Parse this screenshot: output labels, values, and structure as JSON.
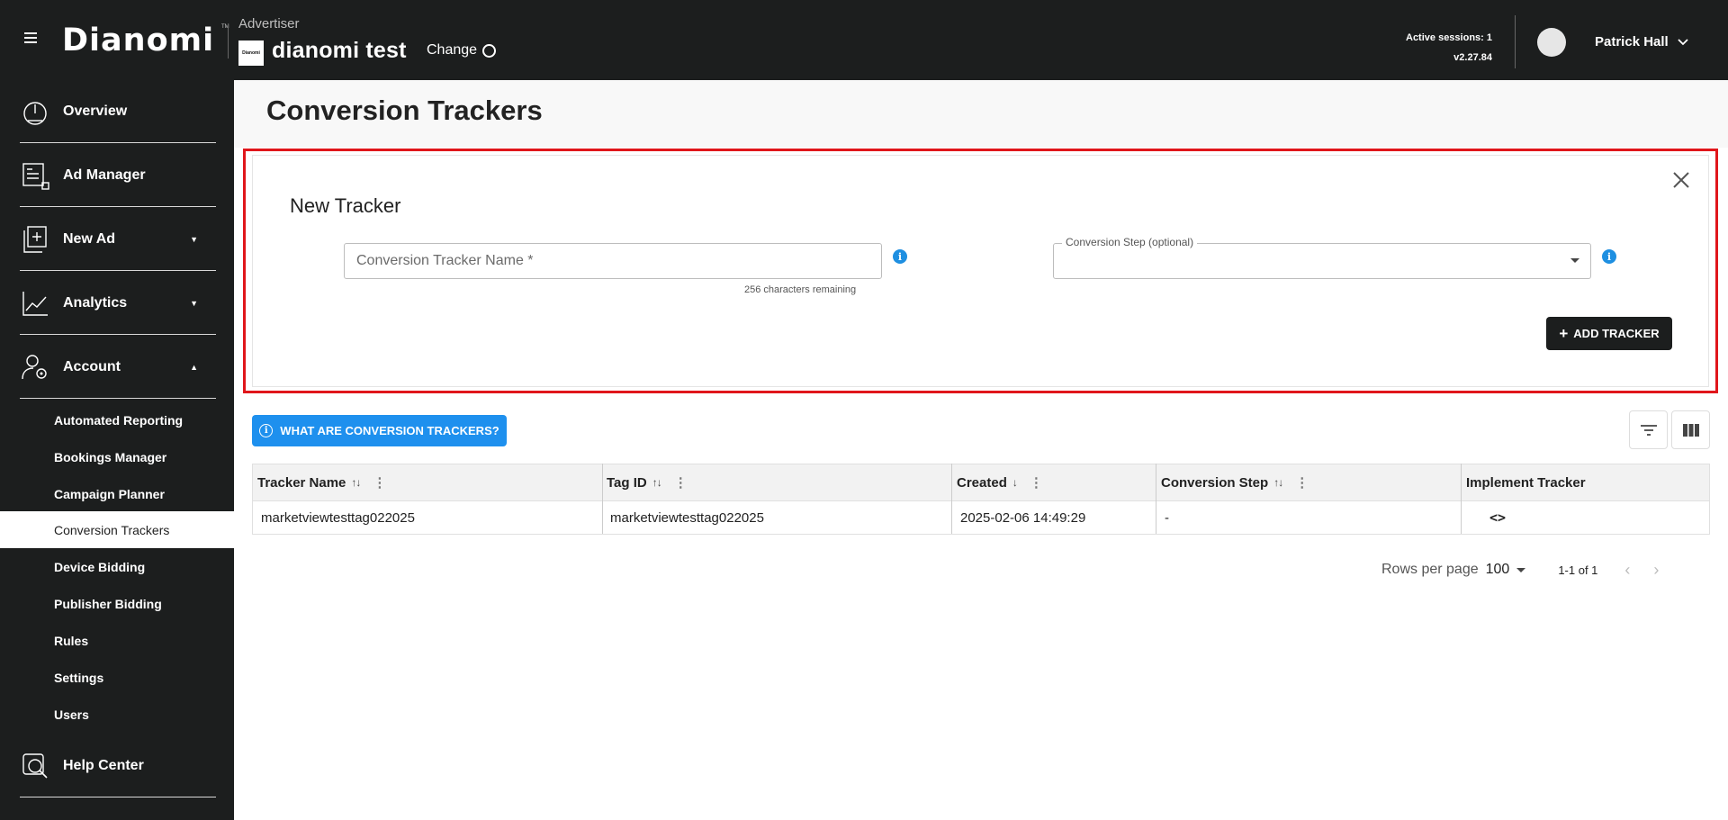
{
  "header": {
    "logo": "Dianomi",
    "logo_tm": "TM",
    "advertiser_label": "Advertiser",
    "advertiser_logo_text": "Dianomi",
    "advertiser_name": "dianomi test",
    "change_label": "Change",
    "active_sessions": "Active sessions: 1",
    "version": "v2.27.84",
    "user_name": "Patrick Hall"
  },
  "sidebar": {
    "items": [
      {
        "label": "Overview",
        "icon": "gauge-icon"
      },
      {
        "label": "Ad Manager",
        "icon": "ad-manager-icon"
      },
      {
        "label": "New Ad",
        "icon": "new-ad-icon"
      },
      {
        "label": "Analytics",
        "icon": "analytics-icon"
      },
      {
        "label": "Account",
        "icon": "account-icon"
      }
    ],
    "sub_items": [
      "Automated Reporting",
      "Bookings Manager",
      "Campaign Planner",
      "Conversion Trackers",
      "Device Bidding",
      "Publisher Bidding",
      "Rules",
      "Settings",
      "Users"
    ],
    "active_sub_item": "Conversion Trackers",
    "help": {
      "label": "Help Center",
      "icon": "help-icon"
    }
  },
  "page": {
    "title": "Conversion Trackers"
  },
  "new_tracker": {
    "title": "New Tracker",
    "name_placeholder": "Conversion Tracker Name *",
    "name_value": "",
    "chars_remaining": "256 characters remaining",
    "step_label": "Conversion Step (optional)",
    "step_value": "",
    "add_button": "ADD TRACKER",
    "info_glyph": "i"
  },
  "toolbar": {
    "what_button": "WHAT ARE CONVERSION TRACKERS?"
  },
  "table": {
    "columns": [
      "Tracker Name",
      "Tag ID",
      "Created",
      "Conversion Step",
      "Implement Tracker"
    ],
    "rows": [
      {
        "tracker_name": "marketviewtesttag022025",
        "tag_id": "marketviewtesttag022025",
        "created": "2025-02-06 14:49:29",
        "conversion_step": "-",
        "implement": "<>"
      }
    ]
  },
  "pagination": {
    "rows_per_page_label": "Rows per page",
    "rows_per_page": "100",
    "range": "1-1 of 1"
  },
  "colors": {
    "dark": "#1c1e1e",
    "accent_blue": "#1e90ee",
    "highlight_red": "#e0161b"
  }
}
